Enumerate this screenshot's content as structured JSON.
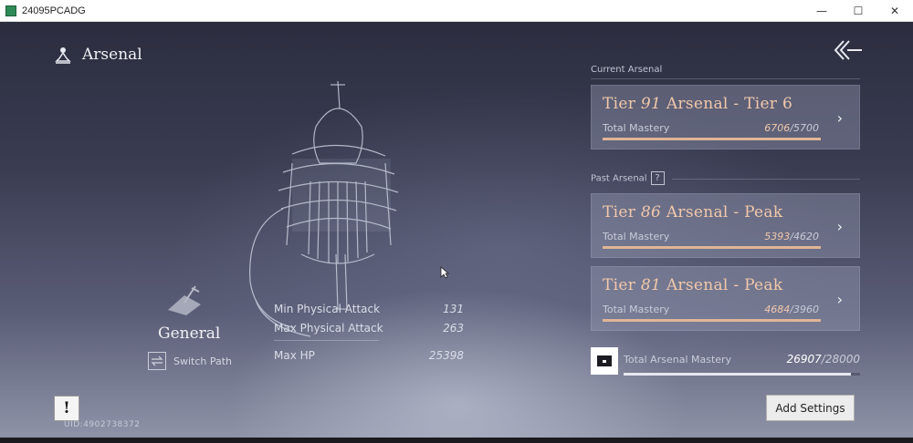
{
  "window": {
    "title": "24095PCADG",
    "minimize": "—",
    "maximize": "☐",
    "close": "✕"
  },
  "header": {
    "title": "Arsenal",
    "meditate_icon": "meditate-icon",
    "back_icon": "back-arrow-icon"
  },
  "character": {
    "class_name": "General",
    "switch_path": "Switch Path",
    "stats": [
      {
        "label": "Min Physical Attack",
        "value": "131"
      },
      {
        "label": "Max Physical Attack",
        "value": "263"
      },
      {
        "label": "Max HP",
        "value": "25398"
      }
    ]
  },
  "current_section": {
    "label": "Current Arsenal"
  },
  "past_section": {
    "label": "Past Arsenal",
    "help": "?"
  },
  "arsenals": [
    {
      "prefix": "Tier ",
      "tier": "91",
      "suffix": " Arsenal - Tier 6",
      "mastery_label": "Total Mastery",
      "mastery": "6706",
      "max": "5700",
      "fill": 1.0
    },
    {
      "prefix": "Tier ",
      "tier": "86",
      "suffix": " Arsenal - Peak",
      "mastery_label": "Total Mastery",
      "mastery": "5393",
      "max": "4620",
      "fill": 1.0
    },
    {
      "prefix": "Tier ",
      "tier": "81",
      "suffix": " Arsenal - Peak",
      "mastery_label": "Total Mastery",
      "mastery": "4684",
      "max": "3960",
      "fill": 1.0
    }
  ],
  "total": {
    "label": "Total Arsenal Mastery",
    "value": "26907",
    "max": "28000",
    "fill": 0.961
  },
  "slash": "/",
  "card_arrow": "›",
  "alert": "!",
  "uid": "UID:4902738372",
  "add_settings": "Add Settings",
  "colors": {
    "accent": "#f2c8ab",
    "bar": "#e0b596"
  }
}
